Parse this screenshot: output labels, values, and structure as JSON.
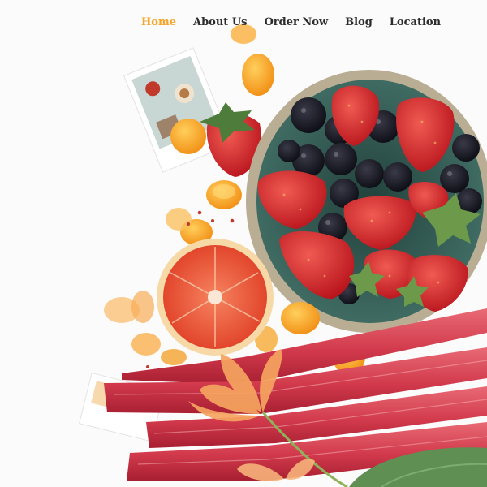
{
  "nav": {
    "items": [
      {
        "label": "Home",
        "active": true
      },
      {
        "label": "About Us",
        "active": false
      },
      {
        "label": "Order Now",
        "active": false
      },
      {
        "label": "Blog",
        "active": false
      },
      {
        "label": "Location",
        "active": false
      }
    ],
    "search_icon": "search-icon"
  },
  "colors": {
    "accent": "#f4a52a",
    "nav_text": "#2b2b2b",
    "background": "#fbfbfb"
  }
}
